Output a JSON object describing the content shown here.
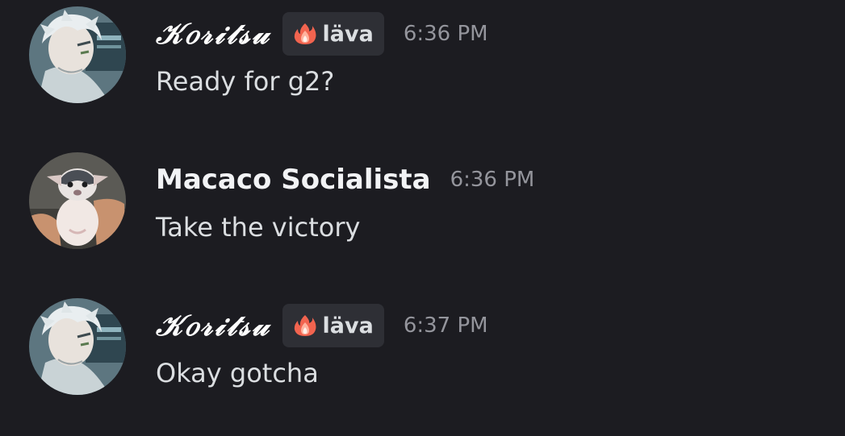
{
  "colors": {
    "background": "#1c1c21",
    "username": "#f2f3f5",
    "message_text": "#dbdee1",
    "timestamp": "#94959c",
    "tag_background": "#2e2f35"
  },
  "messages": [
    {
      "author": "𝒦𝑜𝓇𝒾𝓉𝓈𝓊",
      "author_style": "script",
      "avatar": "anime-character-avatar",
      "tag": {
        "icon": "flame-icon",
        "label": "läva"
      },
      "timestamp": "6:36 PM",
      "content": "Ready for g2?"
    },
    {
      "author": "Macaco Socialista",
      "author_style": "bold",
      "avatar": "puppy-photo-avatar",
      "timestamp": "6:36 PM",
      "content": "Take the victory"
    },
    {
      "author": "𝒦𝑜𝓇𝒾𝓉𝓈𝓊",
      "author_style": "script",
      "avatar": "anime-character-avatar",
      "tag": {
        "icon": "flame-icon",
        "label": "läva"
      },
      "timestamp": "6:37 PM",
      "content": "Okay gotcha"
    }
  ]
}
